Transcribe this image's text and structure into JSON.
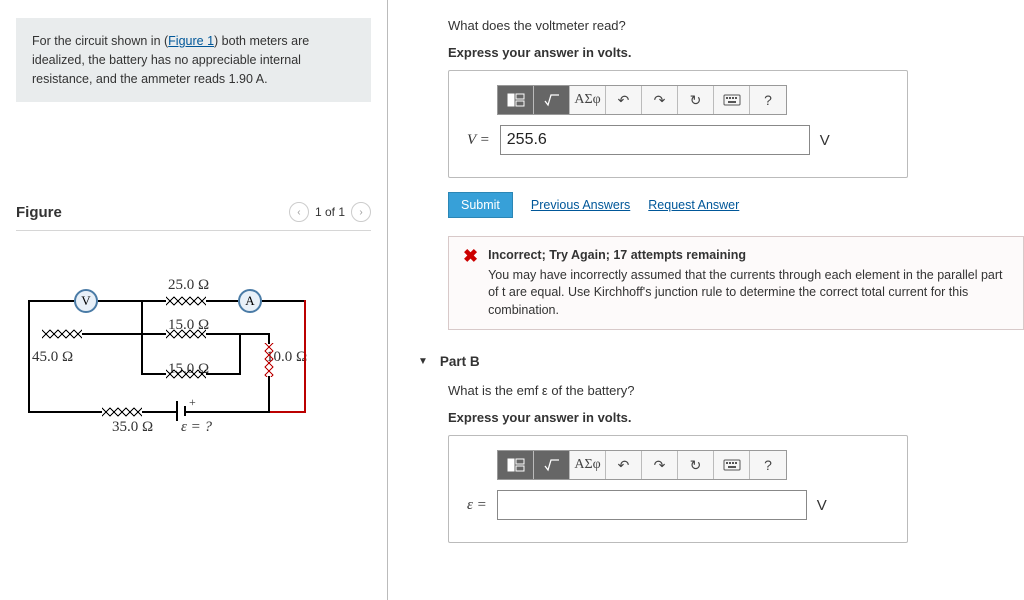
{
  "problem": {
    "pre": "For the circuit shown in (",
    "figlink": "Figure 1",
    "post": ") both meters are idealized, the battery has no appreciable internal resistance, and the ammeter reads 1.90 A."
  },
  "figure": {
    "title": "Figure",
    "counter": "1 of 1"
  },
  "circuit": {
    "r_top": "25.0 Ω",
    "r_mid": "15.0 Ω",
    "r_left": "45.0 Ω",
    "r_par": "15.0 Ω",
    "r_right": "10.0 Ω",
    "r_bottom": "35.0 Ω",
    "emf": "ε = ?",
    "v_meter": "V",
    "a_meter": "A"
  },
  "partA": {
    "question": "What does the voltmeter read?",
    "instruction": "Express your answer in volts.",
    "var": "V =",
    "value": "255.6",
    "unit": "V",
    "submit": "Submit",
    "prev": "Previous Answers",
    "req": "Request Answer",
    "fb_title": "Incorrect; Try Again; 17 attempts remaining",
    "fb_body": "You may have incorrectly assumed that the currents through each element in the parallel part of t are equal. Use Kirchhoff's junction rule to determine the correct total current for this combination."
  },
  "partB": {
    "header": "Part B",
    "question": "What is the emf ε of the battery?",
    "instruction": "Express your answer in volts.",
    "var": "ε =",
    "value": "",
    "unit": "V"
  },
  "toolbar": {
    "sym": "ΑΣφ",
    "help": "?"
  }
}
